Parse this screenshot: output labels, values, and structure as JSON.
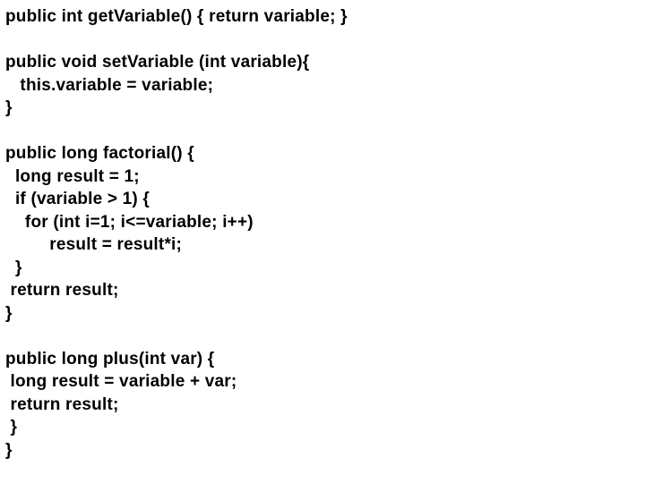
{
  "code": {
    "lines": [
      "public int getVariable() { return variable; }",
      "",
      "public void setVariable (int variable){",
      "   this.variable = variable;",
      "}",
      "",
      "public long factorial() {",
      "  long result = 1;",
      "  if (variable > 1) {",
      "    for (int i=1; i<=variable; i++)",
      "         result = result*i;",
      "  }",
      " return result;",
      "}",
      "",
      "public long plus(int var) {",
      " long result = variable + var;",
      " return result;",
      " }",
      "}"
    ]
  }
}
